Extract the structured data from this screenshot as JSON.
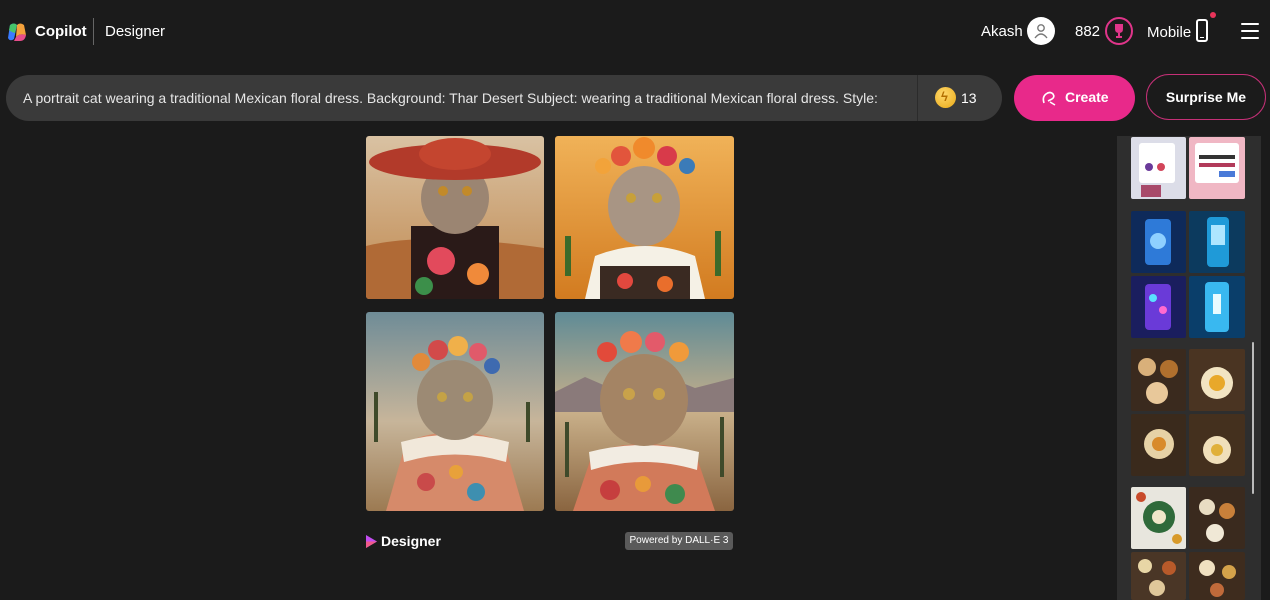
{
  "header": {
    "brand": "Copilot",
    "product": "Designer",
    "user_name": "Akash",
    "points": "882",
    "mobile_label": "Mobile"
  },
  "prompt": {
    "text": "A portrait cat wearing a traditional Mexican floral dress. Background: Thar Desert Subject: wearing a traditional Mexican floral dress. Style: :",
    "boosts": "13"
  },
  "actions": {
    "create_label": "Create",
    "surprise_label": "Surprise Me"
  },
  "results": {
    "footer_brand": "Designer",
    "powered_by": "Powered by DALL·E 3"
  },
  "colors": {
    "accent": "#e8298a",
    "background": "#1b1b1b",
    "prompt_bar": "#3a3a3a"
  }
}
